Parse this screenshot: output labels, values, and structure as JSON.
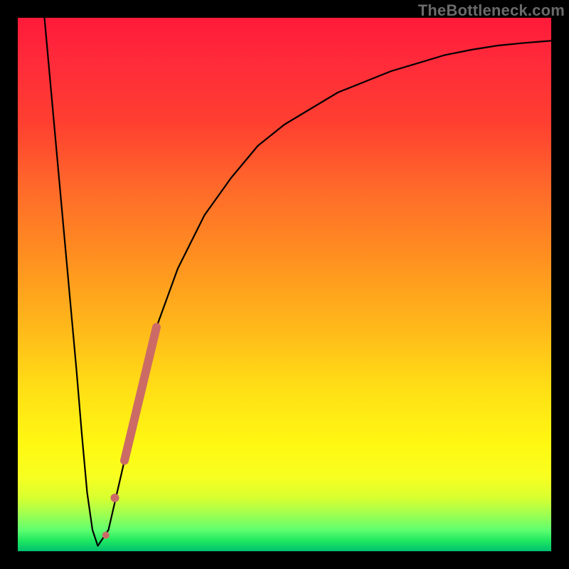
{
  "watermark": "TheBottleneck.com",
  "colors": {
    "background_frame": "#000000",
    "curve": "#000000",
    "highlight": "#cc6b66"
  },
  "chart_data": {
    "type": "line",
    "title": "",
    "xlabel": "",
    "ylabel": "",
    "xlim": [
      0,
      100
    ],
    "ylim": [
      0,
      100
    ],
    "grid": false,
    "legend": false,
    "series": [
      {
        "name": "bottleneck-curve",
        "x": [
          5,
          7,
          9,
          11,
          12,
          13,
          14,
          15,
          17,
          20,
          23,
          26,
          30,
          35,
          40,
          45,
          50,
          55,
          60,
          65,
          70,
          75,
          80,
          85,
          90,
          95,
          100
        ],
        "y": [
          100,
          78,
          56,
          34,
          22,
          11,
          4,
          1,
          4,
          17,
          30,
          42,
          53,
          63,
          70,
          76,
          80,
          83,
          86,
          88,
          90,
          91.5,
          93,
          94,
          94.8,
          95.3,
          95.7
        ]
      }
    ],
    "annotations": [
      {
        "name": "highlight-segment-main",
        "type": "segment",
        "x0": 20,
        "y0": 17,
        "x1": 26,
        "y1": 42,
        "stroke_width": 12
      },
      {
        "name": "highlight-dot-1",
        "type": "dot",
        "x": 18.2,
        "y": 10,
        "r": 6
      },
      {
        "name": "highlight-dot-2",
        "type": "dot",
        "x": 16.5,
        "y": 3,
        "r": 5
      }
    ]
  }
}
